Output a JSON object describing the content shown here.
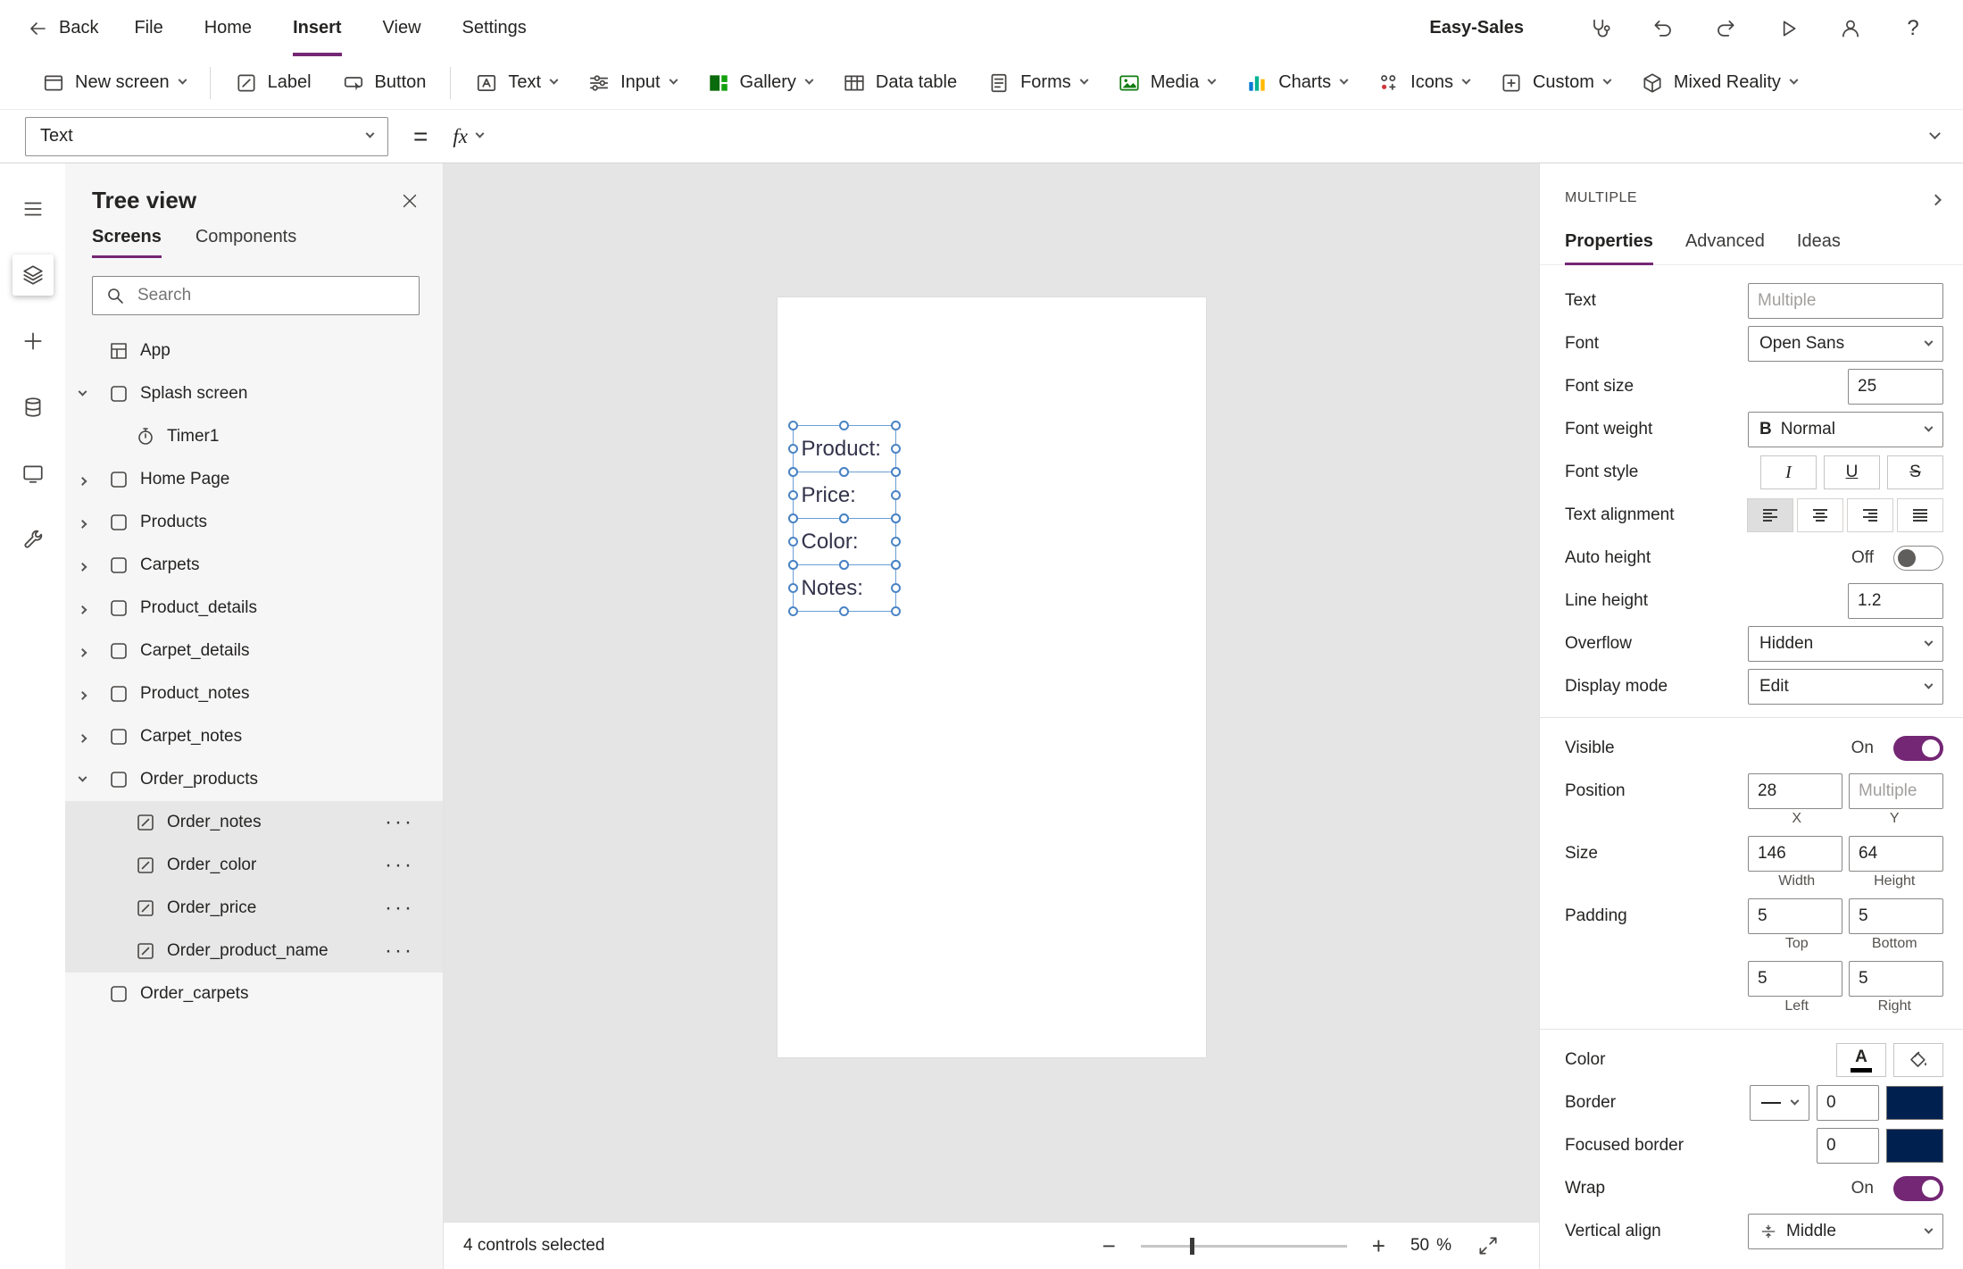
{
  "colors": {
    "accent": "#742774",
    "border_swatch": "#002050",
    "selection_blue": "#4a84c4"
  },
  "menubar": {
    "back_label": "Back",
    "items": [
      {
        "label": "File"
      },
      {
        "label": "Home"
      },
      {
        "label": "Insert"
      },
      {
        "label": "View"
      },
      {
        "label": "Settings"
      }
    ],
    "active_item": "Insert",
    "app_name": "Easy-Sales",
    "help_glyph": "?"
  },
  "ribbon": {
    "items": [
      {
        "label": "New screen"
      },
      {
        "label": "Label"
      },
      {
        "label": "Button"
      },
      {
        "label": "Text"
      },
      {
        "label": "Input"
      },
      {
        "label": "Gallery"
      },
      {
        "label": "Data table"
      },
      {
        "label": "Forms"
      },
      {
        "label": "Media"
      },
      {
        "label": "Charts"
      },
      {
        "label": "Icons"
      },
      {
        "label": "Custom"
      },
      {
        "label": "Mixed Reality"
      }
    ]
  },
  "formula_bar": {
    "property_selector": "Text",
    "equals_glyph": "=",
    "fx_glyph": "fx",
    "input_value": ""
  },
  "tree": {
    "title": "Tree view",
    "tabs": [
      {
        "label": "Screens"
      },
      {
        "label": "Components"
      }
    ],
    "active_tab": "Screens",
    "search_placeholder": "Search",
    "overflow_glyph": "···",
    "items": [
      {
        "label": "App"
      },
      {
        "label": "Splash screen"
      },
      {
        "label": "Timer1"
      },
      {
        "label": "Home Page"
      },
      {
        "label": "Products"
      },
      {
        "label": "Carpets"
      },
      {
        "label": "Product_details"
      },
      {
        "label": "Carpet_details"
      },
      {
        "label": "Product_notes"
      },
      {
        "label": "Carpet_notes"
      },
      {
        "label": "Order_products"
      },
      {
        "label": "Order_notes"
      },
      {
        "label": "Order_color"
      },
      {
        "label": "Order_price"
      },
      {
        "label": "Order_product_name"
      },
      {
        "label": "Order_carpets"
      }
    ]
  },
  "canvas": {
    "labels": [
      {
        "text": "Product:"
      },
      {
        "text": "Price:"
      },
      {
        "text": "Color:"
      },
      {
        "text": "Notes:"
      }
    ]
  },
  "statusbar": {
    "selection_text": "4 controls selected",
    "zoom_minus": "−",
    "zoom_plus": "+",
    "zoom_value": "50",
    "zoom_unit": "%"
  },
  "properties_panel": {
    "header": "MULTIPLE",
    "tabs": [
      {
        "label": "Properties"
      },
      {
        "label": "Advanced"
      },
      {
        "label": "Ideas"
      }
    ],
    "active_tab": "Properties",
    "text": {
      "label": "Text",
      "value": "Multiple"
    },
    "font": {
      "label": "Font",
      "value": "Open Sans"
    },
    "font_size": {
      "label": "Font size",
      "value": "25"
    },
    "font_weight": {
      "label": "Font weight",
      "value": "Normal",
      "bold_glyph": "B"
    },
    "font_style": {
      "label": "Font style",
      "italic_glyph": "I",
      "underline_glyph": "U",
      "strike_glyph": "S"
    },
    "text_alignment": {
      "label": "Text alignment"
    },
    "auto_height": {
      "label": "Auto height",
      "state": "Off"
    },
    "line_height": {
      "label": "Line height",
      "value": "1.2"
    },
    "overflow": {
      "label": "Overflow",
      "value": "Hidden"
    },
    "display_mode": {
      "label": "Display mode",
      "value": "Edit"
    },
    "visible": {
      "label": "Visible",
      "state": "On"
    },
    "position": {
      "label": "Position",
      "x_value": "28",
      "y_placeholder": "Multiple",
      "x_label": "X",
      "y_label": "Y"
    },
    "size": {
      "label": "Size",
      "width_value": "146",
      "height_value": "64",
      "width_label": "Width",
      "height_label": "Height"
    },
    "padding": {
      "label": "Padding",
      "top_value": "5",
      "bottom_value": "5",
      "left_value": "5",
      "right_value": "5",
      "top_label": "Top",
      "bottom_label": "Bottom",
      "left_label": "Left",
      "right_label": "Right"
    },
    "color": {
      "label": "Color",
      "font_color_glyph": "A"
    },
    "border": {
      "label": "Border",
      "width_value": "0"
    },
    "focused_border": {
      "label": "Focused border",
      "width_value": "0"
    },
    "wrap": {
      "label": "Wrap",
      "state": "On"
    },
    "vertical_align": {
      "label": "Vertical align",
      "value": "Middle"
    }
  }
}
